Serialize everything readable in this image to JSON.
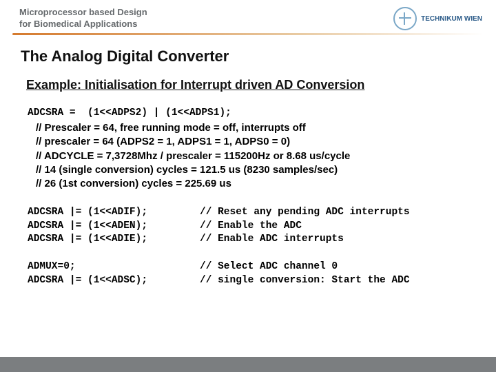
{
  "header": {
    "course_line1": "Microprocessor based Design",
    "course_line2": "for Biomedical Applications",
    "logo_text": "TECHNIKUM WIEN"
  },
  "title": "The Analog Digital Converter",
  "subtitle": "Example: Initialisation for Interrupt driven AD Conversion",
  "code": {
    "line1": "ADCSRA =  (1<<ADPS2) | (1<<ADPS1);"
  },
  "comments": {
    "c1": "// Prescaler = 64, free running mode = off, interrupts off",
    "c2": "// prescaler = 64 (ADPS2 = 1, ADPS1 = 1, ADPS0 = 0)",
    "c3": "// ADCYCLE = 7,3728Mhz / prescaler = 115200Hz or 8.68 us/cycle",
    "c4": "// 14 (single conversion) cycles = 121.5 us (8230 samples/sec)",
    "c5": "// 26 (1st conversion) cycles = 225.69 us"
  },
  "block2": [
    {
      "lhs": "ADCSRA |= (1<<ADIF);",
      "rhs": "// Reset any pending ADC interrupts"
    },
    {
      "lhs": "ADCSRA |= (1<<ADEN);",
      "rhs": "// Enable the ADC"
    },
    {
      "lhs": "ADCSRA |= (1<<ADIE);",
      "rhs": "// Enable ADC interrupts"
    }
  ],
  "block3": [
    {
      "lhs": "ADMUX=0;",
      "rhs": "// Select ADC channel 0"
    },
    {
      "lhs": "ADCSRA |= (1<<ADSC);",
      "rhs": "// single conversion: Start the ADC"
    }
  ]
}
